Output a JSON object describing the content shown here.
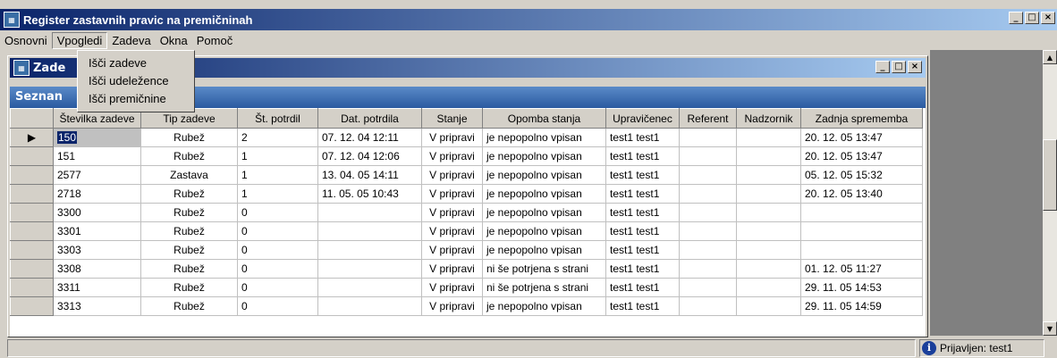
{
  "app": {
    "title": "Register zastavnih pravic na premičninah",
    "icon": "app-icon"
  },
  "menu": {
    "items": [
      "Osnovni",
      "Vpogledi",
      "Zadeva",
      "Okna",
      "Pomoč"
    ],
    "open_index": 1,
    "dropdown": [
      "Išči zadeve",
      "Išči udeležence",
      "Išči premičnine"
    ]
  },
  "child_window": {
    "title": "Zade",
    "panel_title": "Seznan"
  },
  "table": {
    "columns": [
      "Številka zadeve",
      "Tip zadeve",
      "Št. potrdil",
      "Dat. potrdila",
      "Stanje",
      "Opomba stanja",
      "Upravičenec",
      "Referent",
      "Nadzornik",
      "Zadnja sprememba"
    ],
    "rows": [
      [
        "150",
        "Rubež",
        "2",
        "07. 12. 04 12:11",
        "V pripravi",
        "je nepopolno vpisan",
        "test1 test1",
        "",
        "",
        "20. 12. 05 13:47"
      ],
      [
        "151",
        "Rubež",
        "1",
        "07. 12. 04 12:06",
        "V pripravi",
        "je nepopolno vpisan",
        "test1 test1",
        "",
        "",
        "20. 12. 05 13:47"
      ],
      [
        "2577",
        "Zastava",
        "1",
        "13. 04. 05 14:11",
        "V pripravi",
        "je nepopolno vpisan",
        "test1 test1",
        "",
        "",
        "05. 12. 05 15:32"
      ],
      [
        "2718",
        "Rubež",
        "1",
        "11. 05. 05 10:43",
        "V pripravi",
        "je nepopolno vpisan",
        "test1 test1",
        "",
        "",
        "20. 12. 05 13:40"
      ],
      [
        "3300",
        "Rubež",
        "0",
        "",
        "V pripravi",
        "je nepopolno vpisan",
        "test1 test1",
        "",
        "",
        ""
      ],
      [
        "3301",
        "Rubež",
        "0",
        "",
        "V pripravi",
        "je nepopolno vpisan",
        "test1 test1",
        "",
        "",
        ""
      ],
      [
        "3303",
        "Rubež",
        "0",
        "",
        "V pripravi",
        "je nepopolno vpisan",
        "test1 test1",
        "",
        "",
        ""
      ],
      [
        "3308",
        "Rubež",
        "0",
        "",
        "V pripravi",
        "ni še potrjena s strani",
        "test1 test1",
        "",
        "",
        "01. 12. 05 11:27"
      ],
      [
        "3311",
        "Rubež",
        "0",
        "",
        "V pripravi",
        "ni še potrjena s strani",
        "test1 test1",
        "",
        "",
        "29. 11. 05 14:53"
      ],
      [
        "3313",
        "Rubež",
        "0",
        "",
        "V pripravi",
        "je nepopolno vpisan",
        "test1 test1",
        "",
        "",
        "29. 11. 05 14:59"
      ]
    ],
    "selected_row": 0
  },
  "status": {
    "user_label": "Prijavljen: test1",
    "icon": "info-icon"
  }
}
